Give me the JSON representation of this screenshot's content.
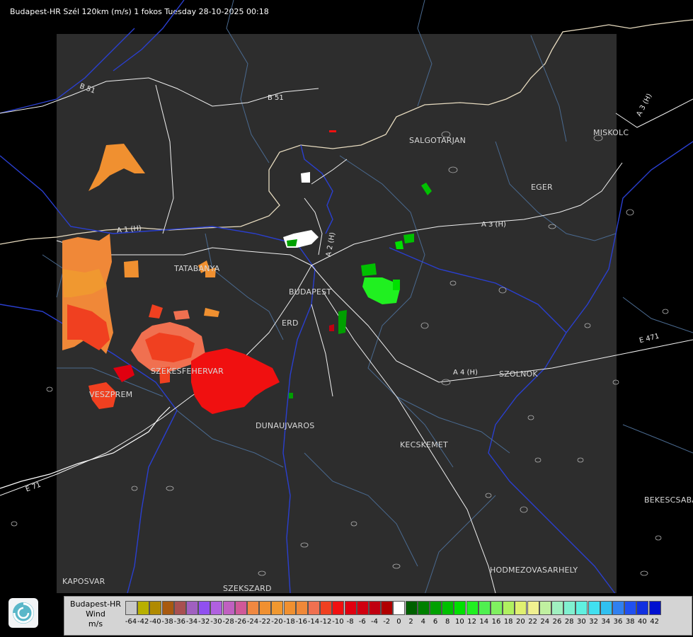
{
  "header": {
    "title": "Budapest-HR Szél 120km (m/s) 1 fokos Tuesday 28-10-2025 00:18"
  },
  "cities": [
    {
      "id": "salgotarjan",
      "name": "SALGOTARJAN"
    },
    {
      "id": "miskolc",
      "name": "MISKOLC"
    },
    {
      "id": "eger",
      "name": "EGER"
    },
    {
      "id": "tatabanya",
      "name": "TATABANYA"
    },
    {
      "id": "budapest",
      "name": "BUDAPEST"
    },
    {
      "id": "erd",
      "name": "ERD"
    },
    {
      "id": "szekesfehervar",
      "name": "SZEKESFEHERVAR"
    },
    {
      "id": "veszprem",
      "name": "VESZPREM"
    },
    {
      "id": "dunaujvaros",
      "name": "DUNAUJVAROS"
    },
    {
      "id": "kecskemet",
      "name": "KECSKEMET"
    },
    {
      "id": "szolnok",
      "name": "SZOLNOK"
    },
    {
      "id": "bekescsaba",
      "name": "BEKESCSABA"
    },
    {
      "id": "hodmezovasarhely",
      "name": "HODMEZOVASARHELY"
    },
    {
      "id": "kaposvar",
      "name": "KAPOSVAR"
    },
    {
      "id": "szekszard",
      "name": "SZEKSZARD"
    }
  ],
  "roads": [
    {
      "id": "b51-west",
      "name": "B 51"
    },
    {
      "id": "b51-east",
      "name": "B 51"
    },
    {
      "id": "a1",
      "name": "A 1 (H)"
    },
    {
      "id": "a2",
      "name": "A 2 (H)"
    },
    {
      "id": "a3",
      "name": "A 3 (H)"
    },
    {
      "id": "a3-north",
      "name": "A 3 (H)"
    },
    {
      "id": "a4",
      "name": "A 4 (H)"
    },
    {
      "id": "e71",
      "name": "E 71"
    },
    {
      "id": "e471",
      "name": "E 471"
    }
  ],
  "legend": {
    "line1": "Budapest-HR",
    "line2": "Wind",
    "unit": "m/s",
    "ticks": [
      "-64",
      "-42",
      "-40",
      "-38",
      "-36",
      "-34",
      "-32",
      "-30",
      "-28",
      "-26",
      "-24",
      "-22",
      "-20",
      "-18",
      "-16",
      "-14",
      "-12",
      "-10",
      "-8",
      "-6",
      "-4",
      "-2",
      "0",
      "2",
      "4",
      "6",
      "8",
      "10",
      "12",
      "14",
      "16",
      "18",
      "20",
      "22",
      "24",
      "26",
      "28",
      "30",
      "32",
      "34",
      "36",
      "38",
      "40",
      "42"
    ],
    "colors": [
      "#c8c8c8",
      "#b8b000",
      "#b08a00",
      "#a85a10",
      "#a85050",
      "#a060c0",
      "#9050f0",
      "#b060e0",
      "#c060c0",
      "#d05898",
      "#f08840",
      "#f09030",
      "#f09830",
      "#f09030",
      "#f08838",
      "#f07050",
      "#f04020",
      "#f01010",
      "#e00010",
      "#d00010",
      "#c00010",
      "#b00000",
      "#ffffff",
      "#006000",
      "#008000",
      "#00a000",
      "#00c000",
      "#00e000",
      "#20f020",
      "#50f050",
      "#80f060",
      "#b0f060",
      "#e0f070",
      "#f0f090",
      "#c0f0a0",
      "#a0f0c0",
      "#80f0d0",
      "#60f0e0",
      "#40e0f0",
      "#30c0f0",
      "#3080f0",
      "#2050f0",
      "#1030e0",
      "#0010d0"
    ]
  }
}
